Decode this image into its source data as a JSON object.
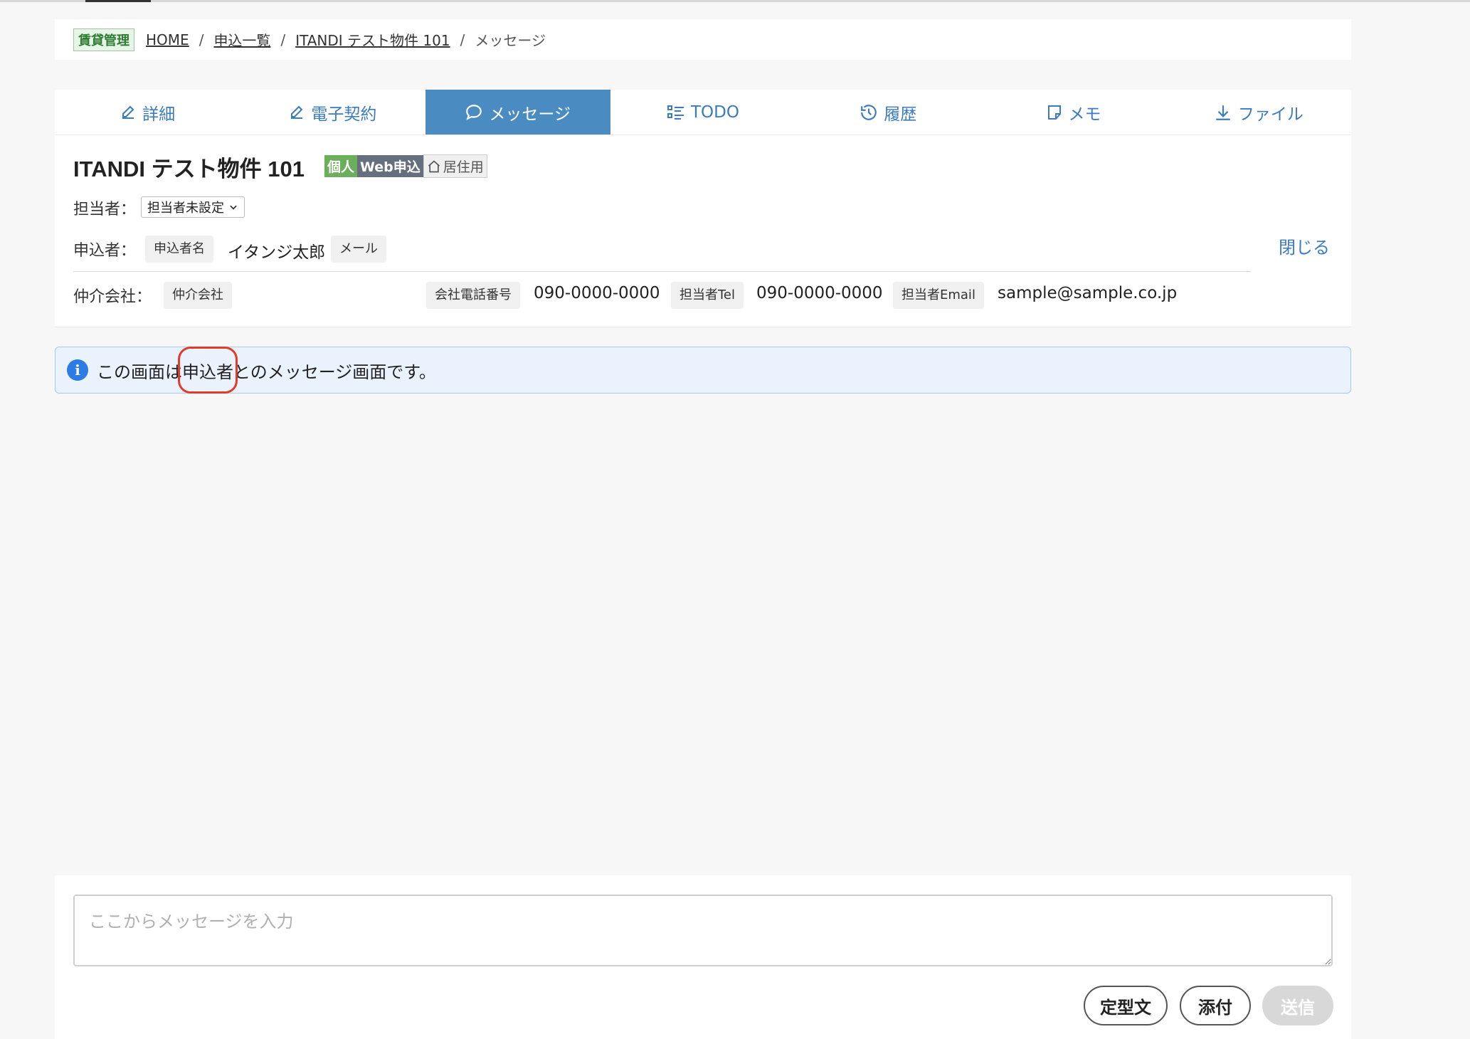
{
  "breadcrumb": {
    "badge": "賃貸管理",
    "items": [
      "HOME",
      "申込一覧",
      "ITANDI テスト物件 101"
    ],
    "current": "メッセージ",
    "separator": "/"
  },
  "tabs": [
    {
      "label": "詳細",
      "icon": "pencil-icon"
    },
    {
      "label": "電子契約",
      "icon": "pencil-icon"
    },
    {
      "label": "メッセージ",
      "icon": "chat-bubble-icon",
      "active": true
    },
    {
      "label": "TODO",
      "icon": "checklist-icon"
    },
    {
      "label": "履歴",
      "icon": "history-icon"
    },
    {
      "label": "メモ",
      "icon": "note-icon"
    },
    {
      "label": "ファイル",
      "icon": "download-icon"
    }
  ],
  "property": {
    "title": "ITANDI テスト物件 101",
    "badges": {
      "personal": "個人",
      "web": "Web申込",
      "residential": "居住用"
    }
  },
  "assignee": {
    "label": "担当者：",
    "selected": "担当者未設定"
  },
  "applicant": {
    "label": "申込者：",
    "name_chip": "申込者名",
    "name": "イタンジ太郎",
    "mail_chip": "メール"
  },
  "close_label": "閉じる",
  "broker": {
    "label": "仲介会社：",
    "company_chip": "仲介会社",
    "phone_chip": "会社電話番号",
    "phone": "090-0000-0000",
    "tel_chip": "担当者Tel",
    "tel": "090-0000-0000",
    "email_chip": "担当者Email",
    "email": "sample@sample.co.jp"
  },
  "notice": {
    "pre": "この画面は",
    "highlight": "申込者",
    "post": "とのメッセージ画面です。"
  },
  "composer": {
    "placeholder": "ここからメッセージを入力",
    "template_button": "定型文",
    "attach_button": "添付",
    "send_button": "送信"
  },
  "colors": {
    "accent": "#4a8bc2",
    "link": "#3b7bbf",
    "highlight_ring": "#e23b2a",
    "notice_bg": "#eaf2fd"
  }
}
